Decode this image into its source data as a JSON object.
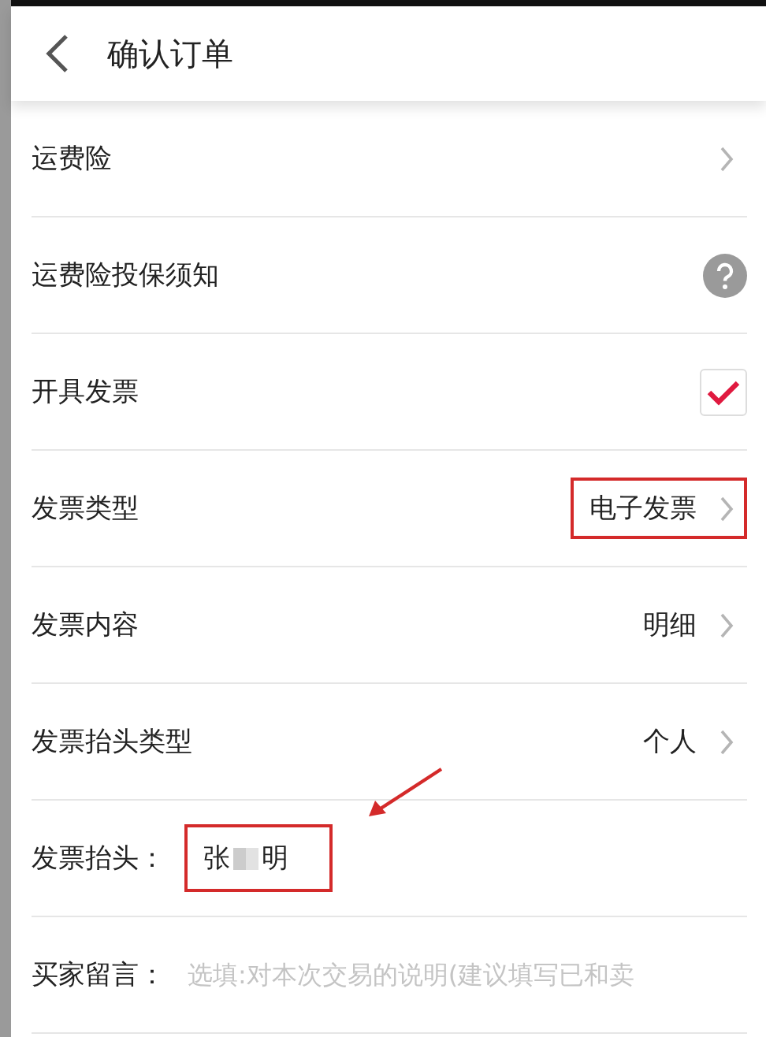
{
  "header": {
    "title": "确认订单"
  },
  "rows": [
    {
      "kind": "link",
      "label": "运费险",
      "highlighted": false
    },
    {
      "kind": "help",
      "label": "运费险投保须知"
    },
    {
      "kind": "checkbox",
      "label": "开具发票",
      "checked": true
    },
    {
      "kind": "link",
      "label": "发票类型",
      "value": "电子发票",
      "highlighted": true
    },
    {
      "kind": "link",
      "label": "发票内容",
      "value": "明细",
      "highlighted": false
    },
    {
      "kind": "link",
      "label": "发票抬头类型",
      "value": "个人",
      "highlighted": false
    },
    {
      "kind": "name",
      "label": "发票抬头：",
      "value_parts": [
        "张",
        "明"
      ],
      "highlighted": true,
      "arrow": true
    },
    {
      "kind": "field",
      "label": "买家留言：",
      "placeholder": "选填:对本次交易的说明(建议填写已和卖"
    }
  ]
}
